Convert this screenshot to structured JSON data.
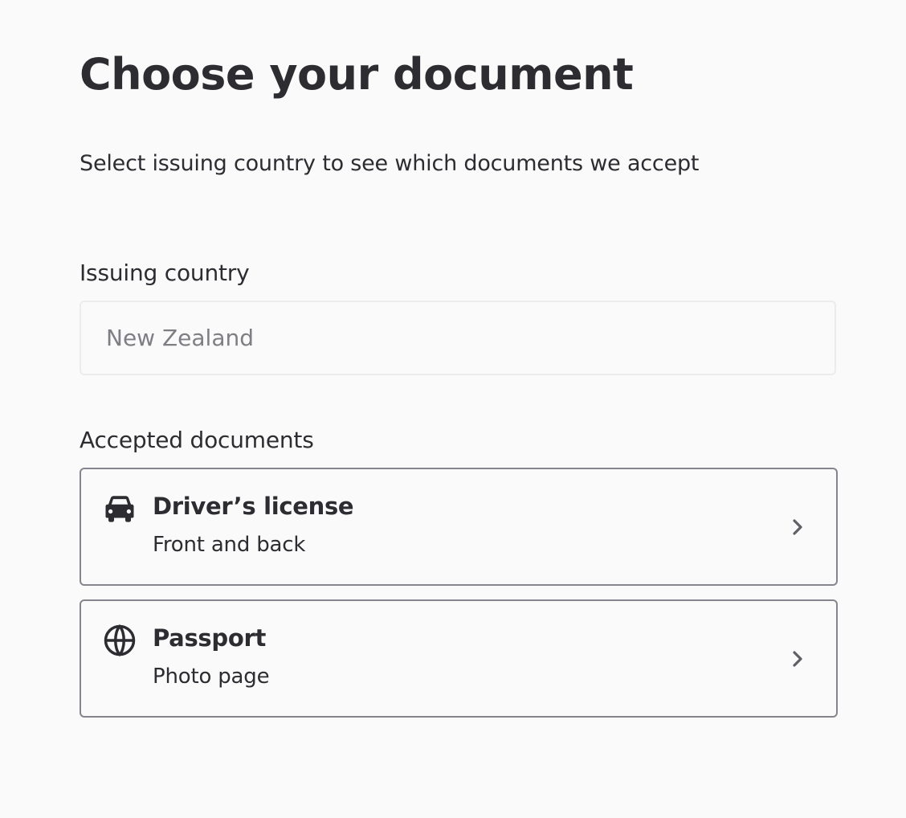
{
  "header": {
    "title": "Choose your document",
    "subtitle": "Select issuing country to see which documents we accept"
  },
  "country_field": {
    "label": "Issuing country",
    "value": "New Zealand"
  },
  "documents": {
    "section_label": "Accepted documents",
    "items": [
      {
        "title": "Driver’s license",
        "description": "Front and back",
        "icon": "car-icon"
      },
      {
        "title": "Passport",
        "description": "Photo page",
        "icon": "globe-icon"
      }
    ]
  },
  "colors": {
    "background": "#fafafa",
    "text": "#2c2c31",
    "card_border": "#85858d",
    "input_border": "#ececee",
    "placeholder_text": "#7e7e84",
    "chevron": "#5f5f66"
  }
}
